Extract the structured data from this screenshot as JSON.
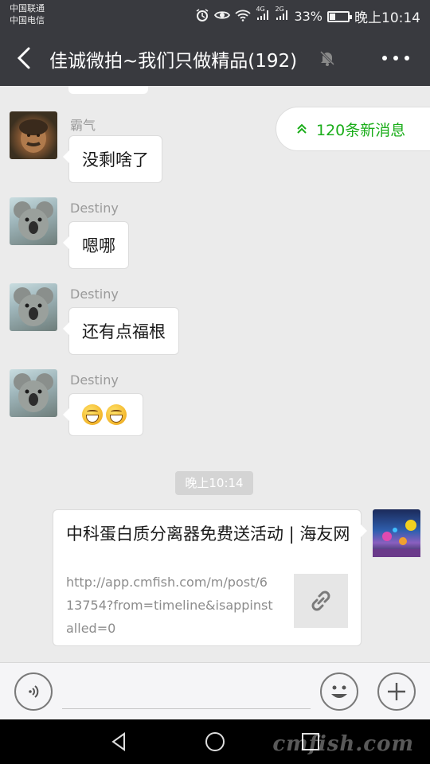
{
  "status_bar": {
    "carrier_1": "中国联通",
    "carrier_2": "中国电信",
    "signal_1_label": "4G",
    "signal_2_label": "2G",
    "battery": "33%",
    "battery_level": 0.33,
    "time": "晚上10:14",
    "icons": [
      "alarm-icon",
      "eye-icon",
      "wifi-icon",
      "signal-icon",
      "battery-icon"
    ]
  },
  "header": {
    "title": "佳诚微拍~我们只做精品(192)",
    "back_icon": "chevron-left-icon",
    "mute_icon": "bell-off-icon",
    "more_icon": "more-icon"
  },
  "new_messages": {
    "label": "120条新消息",
    "icon": "double-chevron-up-icon",
    "color": "#1aad19"
  },
  "messages": [
    {
      "sender": "霸气",
      "text": "没剩啥了"
    },
    {
      "sender": "Destiny",
      "text": "嗯哪"
    },
    {
      "sender": "Destiny",
      "text": "还有点福根"
    },
    {
      "sender": "Destiny",
      "emoji": "grin-emoji"
    }
  ],
  "timestamp": "晚上10:14",
  "link_card": {
    "title": "中科蛋白质分离器免费送活动 | 海友网",
    "url": "http://app.cmfish.com/m/post/613754?from=timeline&isappinstalled=0",
    "thumb_icon": "link-icon"
  },
  "input_bar": {
    "placeholder": "",
    "voice_icon": "voice-icon",
    "emoji_icon": "smiley-icon",
    "plus_icon": "plus-icon"
  },
  "watermark": "cmfish.com",
  "colors": {
    "header_bg": "#393a3f",
    "chat_bg": "#ebebeb",
    "accent_green": "#1aad19"
  }
}
